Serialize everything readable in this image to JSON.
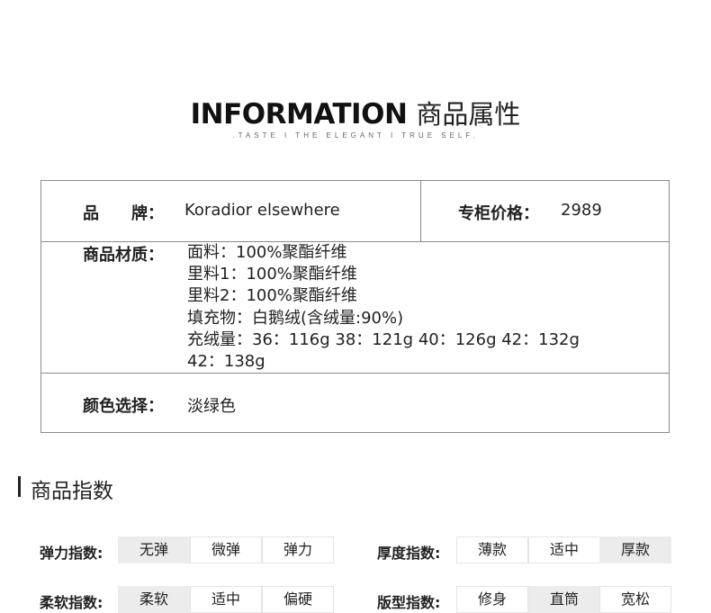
{
  "header": {
    "title_en": "INFORMATION",
    "title_cn": "商品属性",
    "tagline": ".TASTE I THE ELEGANT I TRUE SELF."
  },
  "info": {
    "brand_label": "品　　牌：",
    "brand_value": "Koradior elsewhere",
    "price_label": "专柜价格：",
    "price_value": "2989",
    "material_label": "商品材质：",
    "material_lines": [
      "面料：100%聚酯纤维",
      "里料1：100%聚酯纤维",
      "里料2：100%聚酯纤维",
      "填充物：白鹅绒(含绒量:90%)",
      "充绒量：36：116g 38：121g 40：126g 42：132g",
      "42：138g"
    ],
    "color_label": "颜色选择：",
    "color_value": "淡绿色"
  },
  "indices_section": {
    "title": "商品指数"
  },
  "indices": [
    {
      "label": "弹力指数:",
      "options": [
        "无弹",
        "微弹",
        "弹力"
      ],
      "selected": 0
    },
    {
      "label": "厚度指数:",
      "options": [
        "薄款",
        "适中",
        "厚款"
      ],
      "selected": 2
    },
    {
      "label": "柔软指数:",
      "options": [
        "柔软",
        "适中",
        "偏硬"
      ],
      "selected": 0
    },
    {
      "label": "版型指数:",
      "options": [
        "修身",
        "直筒",
        "宽松"
      ],
      "selected": 1
    }
  ],
  "colors": {
    "selected_bg": "#ececec",
    "border": "#8a8a8a"
  }
}
